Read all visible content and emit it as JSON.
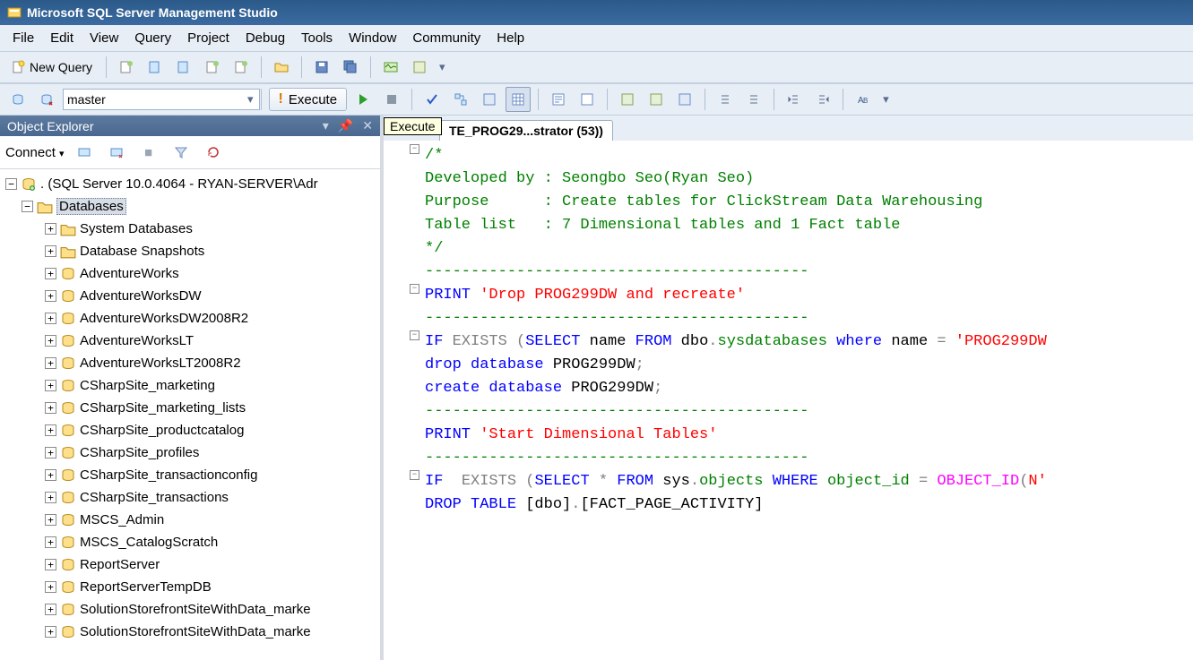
{
  "app": {
    "title": "Microsoft SQL Server Management Studio"
  },
  "menu": [
    "File",
    "Edit",
    "View",
    "Query",
    "Project",
    "Debug",
    "Tools",
    "Window",
    "Community",
    "Help"
  ],
  "toolbar1": {
    "newQuery": "New Query"
  },
  "toolbar2": {
    "dbSelected": "master",
    "execute": "Execute"
  },
  "sidebar": {
    "title": "Object Explorer",
    "connect": "Connect",
    "root": ". (SQL Server 10.0.4064 - RYAN-SERVER\\Adr",
    "databasesLabel": "Databases",
    "folders": [
      "System Databases",
      "Database Snapshots"
    ],
    "dbs": [
      "AdventureWorks",
      "AdventureWorksDW",
      "AdventureWorksDW2008R2",
      "AdventureWorksLT",
      "AdventureWorksLT2008R2",
      "CSharpSite_marketing",
      "CSharpSite_marketing_lists",
      "CSharpSite_productcatalog",
      "CSharpSite_profiles",
      "CSharpSite_transactionconfig",
      "CSharpSite_transactions",
      "MSCS_Admin",
      "MSCS_CatalogScratch",
      "ReportServer",
      "ReportServerTempDB",
      "SolutionStorefrontSiteWithData_marke",
      "SolutionStorefrontSiteWithData_marke"
    ]
  },
  "editor": {
    "tooltip": "Execute",
    "tabTitle": "TE_PROG29...strator (53))",
    "lines": [
      {
        "fold": "-",
        "segs": [
          {
            "t": "/*",
            "c": "c-comment"
          }
        ]
      },
      {
        "segs": [
          {
            "t": "Developed by : Seongbo Seo(Ryan Seo)",
            "c": "c-comment"
          }
        ]
      },
      {
        "segs": [
          {
            "t": "Purpose      : Create tables for ClickStream Data Warehousing",
            "c": "c-comment"
          }
        ]
      },
      {
        "segs": [
          {
            "t": "Table list   : 7 Dimensional tables and 1 Fact table",
            "c": "c-comment"
          }
        ]
      },
      {
        "segs": [
          {
            "t": "*/",
            "c": "c-comment"
          }
        ]
      },
      {
        "segs": [
          {
            "t": "",
            "c": ""
          }
        ]
      },
      {
        "segs": [
          {
            "t": "------------------------------------------",
            "c": "c-comment"
          }
        ]
      },
      {
        "fold": "-",
        "segs": [
          {
            "t": "PRINT ",
            "c": "c-key"
          },
          {
            "t": "'Drop PROG299DW and recreate'",
            "c": "c-str"
          }
        ]
      },
      {
        "segs": [
          {
            "t": "------------------------------------------",
            "c": "c-comment"
          }
        ]
      },
      {
        "fold": "-",
        "segs": [
          {
            "t": "IF ",
            "c": "c-key"
          },
          {
            "t": "EXISTS ",
            "c": "c-gray"
          },
          {
            "t": "(",
            "c": "c-gray"
          },
          {
            "t": "SELECT",
            "c": "c-key"
          },
          {
            "t": " name ",
            "c": ""
          },
          {
            "t": "FROM",
            "c": "c-key"
          },
          {
            "t": " dbo",
            "c": ""
          },
          {
            "t": ".",
            "c": "c-gray"
          },
          {
            "t": "sysdatabases ",
            "c": "c-sys"
          },
          {
            "t": "where",
            "c": "c-key"
          },
          {
            "t": " name ",
            "c": ""
          },
          {
            "t": "= ",
            "c": "c-gray"
          },
          {
            "t": "'PROG299DW",
            "c": "c-str"
          }
        ]
      },
      {
        "segs": [
          {
            "t": "drop",
            "c": "c-key"
          },
          {
            "t": " ",
            "c": ""
          },
          {
            "t": "database",
            "c": "c-key"
          },
          {
            "t": " PROG299DW",
            "c": ""
          },
          {
            "t": ";",
            "c": "c-gray"
          }
        ]
      },
      {
        "segs": [
          {
            "t": "",
            "c": ""
          }
        ]
      },
      {
        "segs": [
          {
            "t": "create",
            "c": "c-key"
          },
          {
            "t": " ",
            "c": ""
          },
          {
            "t": "database",
            "c": "c-key"
          },
          {
            "t": " PROG299DW",
            "c": ""
          },
          {
            "t": ";",
            "c": "c-gray"
          }
        ]
      },
      {
        "segs": [
          {
            "t": "",
            "c": ""
          }
        ]
      },
      {
        "segs": [
          {
            "t": "------------------------------------------",
            "c": "c-comment"
          }
        ]
      },
      {
        "segs": [
          {
            "t": "PRINT ",
            "c": "c-key"
          },
          {
            "t": "'Start Dimensional Tables'",
            "c": "c-str"
          }
        ]
      },
      {
        "segs": [
          {
            "t": "------------------------------------------",
            "c": "c-comment"
          }
        ]
      },
      {
        "segs": [
          {
            "t": "",
            "c": ""
          }
        ]
      },
      {
        "fold": "-",
        "segs": [
          {
            "t": "IF  ",
            "c": "c-key"
          },
          {
            "t": "EXISTS ",
            "c": "c-gray"
          },
          {
            "t": "(",
            "c": "c-gray"
          },
          {
            "t": "SELECT",
            "c": "c-key"
          },
          {
            "t": " ",
            "c": ""
          },
          {
            "t": "* ",
            "c": "c-gray"
          },
          {
            "t": "FROM",
            "c": "c-key"
          },
          {
            "t": " sys",
            "c": ""
          },
          {
            "t": ".",
            "c": "c-gray"
          },
          {
            "t": "objects ",
            "c": "c-sys"
          },
          {
            "t": "WHERE",
            "c": "c-key"
          },
          {
            "t": " ",
            "c": ""
          },
          {
            "t": "object_id ",
            "c": "c-sys"
          },
          {
            "t": "= ",
            "c": "c-gray"
          },
          {
            "t": "OBJECT_ID",
            "c": "c-func"
          },
          {
            "t": "(",
            "c": "c-gray"
          },
          {
            "t": "N'",
            "c": "c-str"
          }
        ]
      },
      {
        "segs": [
          {
            "t": "DROP",
            "c": "c-key"
          },
          {
            "t": " ",
            "c": ""
          },
          {
            "t": "TABLE",
            "c": "c-key"
          },
          {
            "t": " [dbo]",
            "c": ""
          },
          {
            "t": ".",
            "c": "c-gray"
          },
          {
            "t": "[FACT_PAGE_ACTIVITY]",
            "c": ""
          }
        ]
      }
    ]
  }
}
